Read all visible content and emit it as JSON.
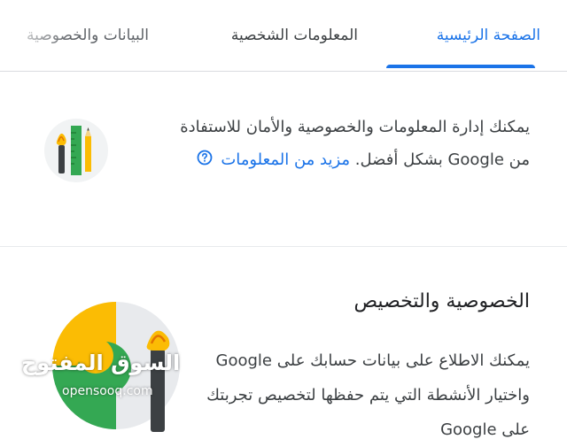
{
  "tabs": [
    {
      "label": "الصفحة الرئيسية",
      "active": true
    },
    {
      "label": "المعلومات الشخصية",
      "active": false
    },
    {
      "label": "البيانات والخصوصية",
      "active": false
    }
  ],
  "intro": {
    "text": "يمكنك إدارة المعلومات والخصوصية والأمان للاستفادة من Google بشكل أفضل.",
    "learn_more": "مزيد من المعلومات",
    "help_icon": "help-circle-icon"
  },
  "privacy_card": {
    "title": "الخصوصية والتخصيص",
    "description": "يمكنك الاطلاع على بيانات حسابك على Google واختيار الأنشطة التي يتم حفظها لتخصيص تجربتك على Google"
  },
  "watermark": {
    "arabic": "السوق المفتوح",
    "english": "opensooq.com"
  },
  "colors": {
    "accent": "#1a73e8",
    "text": "#202124",
    "divider": "#dadce0",
    "green": "#34a853",
    "yellow": "#fbbc04"
  }
}
